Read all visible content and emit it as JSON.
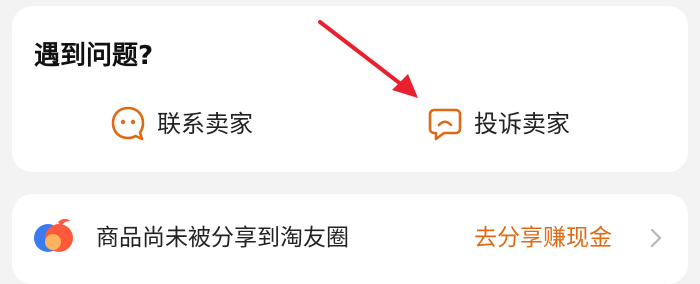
{
  "problem_card": {
    "title": "遇到问题?",
    "contact_seller_label": "联系卖家",
    "complain_seller_label": "投诉卖家",
    "contact_icon": "smiley-chat-icon",
    "complain_icon": "frown-chat-icon"
  },
  "share_card": {
    "text": "商品尚未被分享到淘友圈",
    "cta_label": "去分享赚现金",
    "logo_icon": "taoyouquan-logo-icon",
    "chevron_icon": "chevron-right-icon"
  },
  "colors": {
    "accent": "#e06a14",
    "annotation_arrow": "#e8212f",
    "background": "#f3f3f3",
    "card": "#ffffff"
  }
}
